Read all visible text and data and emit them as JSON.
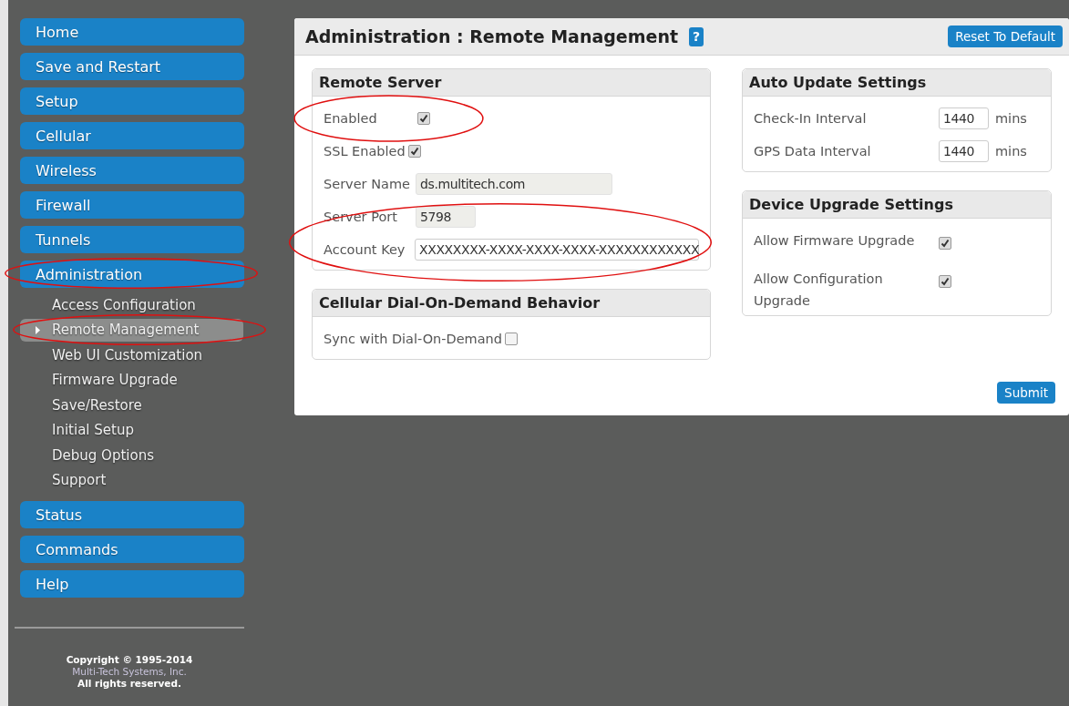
{
  "nav": [
    {
      "label": "Home",
      "circled": false
    },
    {
      "label": "Save and Restart",
      "circled": false
    },
    {
      "label": "Setup",
      "circled": false
    },
    {
      "label": "Cellular",
      "circled": false
    },
    {
      "label": "Wireless",
      "circled": false
    },
    {
      "label": "Firewall",
      "circled": false
    },
    {
      "label": "Tunnels",
      "circled": false
    },
    {
      "label": "Administration",
      "circled": true,
      "children": [
        {
          "label": "Access Configuration",
          "selected": false,
          "circled": false
        },
        {
          "label": "Remote Management",
          "selected": true,
          "circled": true
        },
        {
          "label": "Web UI Customization",
          "selected": false,
          "circled": false
        },
        {
          "label": "Firmware Upgrade",
          "selected": false,
          "circled": false
        },
        {
          "label": "Save/Restore",
          "selected": false,
          "circled": false
        },
        {
          "label": "Initial Setup",
          "selected": false,
          "circled": false
        },
        {
          "label": "Debug Options",
          "selected": false,
          "circled": false
        },
        {
          "label": "Support",
          "selected": false,
          "circled": false
        }
      ]
    },
    {
      "label": "Status",
      "circled": false
    },
    {
      "label": "Commands",
      "circled": false
    },
    {
      "label": "Help",
      "circled": false
    }
  ],
  "footer": [
    "Copyright © 1995-2014",
    "Multi-Tech Systems, Inc.",
    "All rights reserved."
  ],
  "panel": {
    "title": "Administration : Remote Management",
    "help": "?",
    "reset_button": "Reset To Default",
    "submit_button": "Submit",
    "columns": [
      [
        {
          "title": "Remote Server",
          "rows": [
            {
              "kind": "checkbox",
              "label": "Enabled",
              "checked": true,
              "circled": true
            },
            {
              "kind": "checkbox",
              "label": "SSL Enabled",
              "checked": true,
              "circled": false
            },
            {
              "kind": "text-long",
              "label": "Server Name",
              "value": "ds.multitech.com",
              "disabled": true,
              "circled": false
            },
            {
              "kind": "text-short",
              "label": "Server Port",
              "value": "5798",
              "disabled": true,
              "circled": false
            },
            {
              "kind": "text-full",
              "label": "Account Key",
              "value": "XXXXXXXX-XXXX-XXXX-XXXX-XXXXXXXXXXXX",
              "disabled": false,
              "circled": true
            }
          ]
        },
        {
          "title": "Cellular Dial-On-Demand Behavior",
          "rows": [
            {
              "kind": "checkbox",
              "label": "Sync with Dial-On-Demand",
              "checked": false,
              "circled": false
            }
          ]
        }
      ],
      [
        {
          "title": "Auto Update Settings",
          "rows": [
            {
              "kind": "unit",
              "label": "Check-In Interval",
              "value": "1440",
              "unit": "mins",
              "circled": false
            },
            {
              "kind": "unit",
              "label": "GPS Data Interval",
              "value": "1440",
              "unit": "mins",
              "circled": false
            }
          ]
        },
        {
          "title": "Device Upgrade Settings",
          "rows": [
            {
              "kind": "wide-checkbox",
              "label": "Allow Firmware Upgrade",
              "checked": true,
              "circled": false
            },
            {
              "kind": "wide-checkbox",
              "label": "Allow Configuration Upgrade",
              "checked": true,
              "circled": false
            }
          ]
        }
      ]
    ]
  }
}
